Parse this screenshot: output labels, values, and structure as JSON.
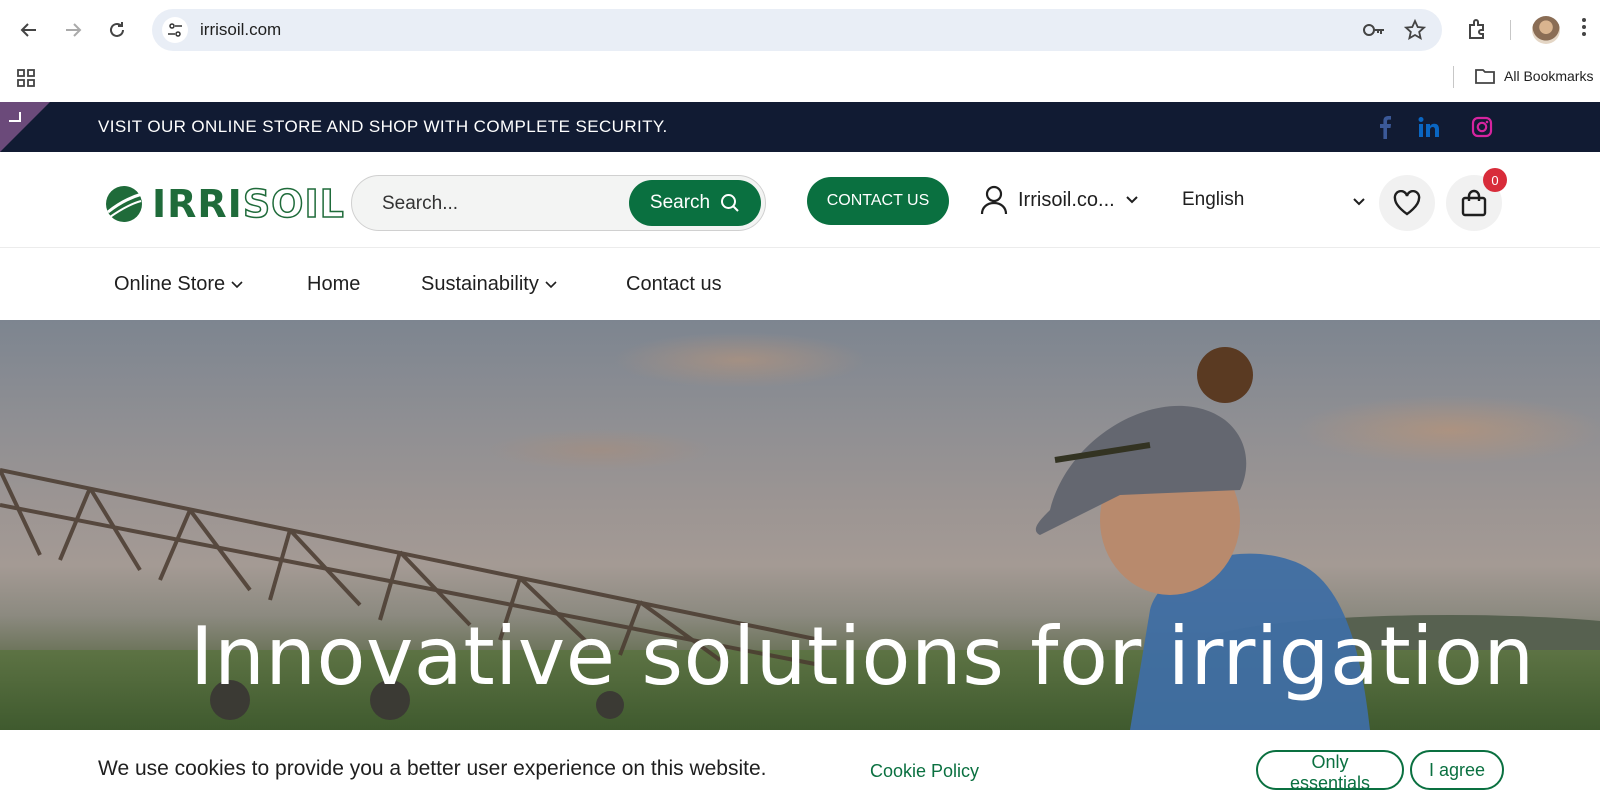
{
  "browser": {
    "url": "irrisoil.com",
    "bookmarks_label": "All Bookmarks"
  },
  "topbar": {
    "message": "VISIT OUR ONLINE STORE AND SHOP WITH COMPLETE SECURITY.",
    "social": [
      "facebook-icon",
      "linkedin-icon",
      "instagram-icon"
    ],
    "colors": {
      "background": "#111b33",
      "facebook": "#3b5998",
      "linkedin": "#0a66c2",
      "instagram": "#d6249f"
    }
  },
  "header": {
    "logo": "IRRISOIL",
    "search": {
      "placeholder": "Search...",
      "button_label": "Search"
    },
    "contact_label": "CONTACT US",
    "account_label": "Irrisoil.co...",
    "language": "English",
    "cart_count": "0",
    "brand_color": "#0a7040"
  },
  "nav": {
    "items": [
      {
        "label": "Online Store",
        "has_dropdown": true
      },
      {
        "label": "Home",
        "has_dropdown": false
      },
      {
        "label": "Sustainability",
        "has_dropdown": true
      },
      {
        "label": "Contact us",
        "has_dropdown": false
      }
    ]
  },
  "hero": {
    "title": "Innovative solutions for irrigation"
  },
  "cookie": {
    "message": "We use cookies to provide you a better user experience on this website.",
    "policy_label": "Cookie Policy",
    "essentials_label": "Only essentials",
    "agree_label": "I agree"
  }
}
